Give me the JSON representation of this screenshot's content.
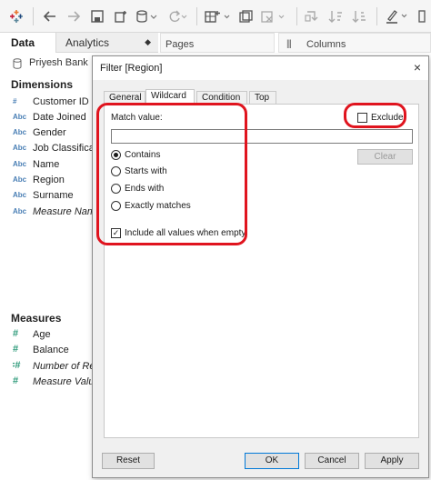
{
  "left_panel": {
    "tab_data": "Data",
    "tab_analytics": "Analytics",
    "datasource": "Priyesh Bank",
    "dimensions_header": "Dimensions",
    "dimensions": [
      {
        "type": "#",
        "label": "Customer ID"
      },
      {
        "type": "Abc",
        "label": "Date Joined"
      },
      {
        "type": "Abc",
        "label": "Gender"
      },
      {
        "type": "Abc",
        "label": "Job Classification"
      },
      {
        "type": "Abc",
        "label": "Name"
      },
      {
        "type": "Abc",
        "label": "Region"
      },
      {
        "type": "Abc",
        "label": "Surname"
      },
      {
        "type": "Abc",
        "label": "Measure Names"
      }
    ],
    "measures_header": "Measures",
    "measures": [
      {
        "type": "#",
        "label": "Age"
      },
      {
        "type": "#",
        "label": "Balance"
      },
      {
        "type": "=#",
        "label": "Number of Records"
      },
      {
        "type": "#",
        "label": "Measure Values"
      }
    ]
  },
  "shelves": {
    "pages": "Pages",
    "columns": "Columns"
  },
  "dialog": {
    "title": "Filter [Region]",
    "close": "×",
    "tabs": [
      "General",
      "Wildcard",
      "Condition",
      "Top"
    ],
    "active_tab": "Wildcard",
    "match_value_label": "Match value:",
    "match_value": "",
    "exclude_label": "Exclude",
    "exclude_checked": false,
    "clear_label": "Clear",
    "options": [
      {
        "label": "Contains",
        "checked": true
      },
      {
        "label": "Starts with",
        "checked": false
      },
      {
        "label": "Ends with",
        "checked": false
      },
      {
        "label": "Exactly matches",
        "checked": false
      }
    ],
    "include_all_label": "Include all values when empty",
    "include_all_checked": true,
    "buttons": {
      "reset": "Reset",
      "ok": "OK",
      "cancel": "Cancel",
      "apply": "Apply"
    }
  },
  "colors": {
    "highlight": "#e0141e",
    "dimension_icon": "#4a7fb5",
    "measure_icon": "#2e9a7a"
  }
}
